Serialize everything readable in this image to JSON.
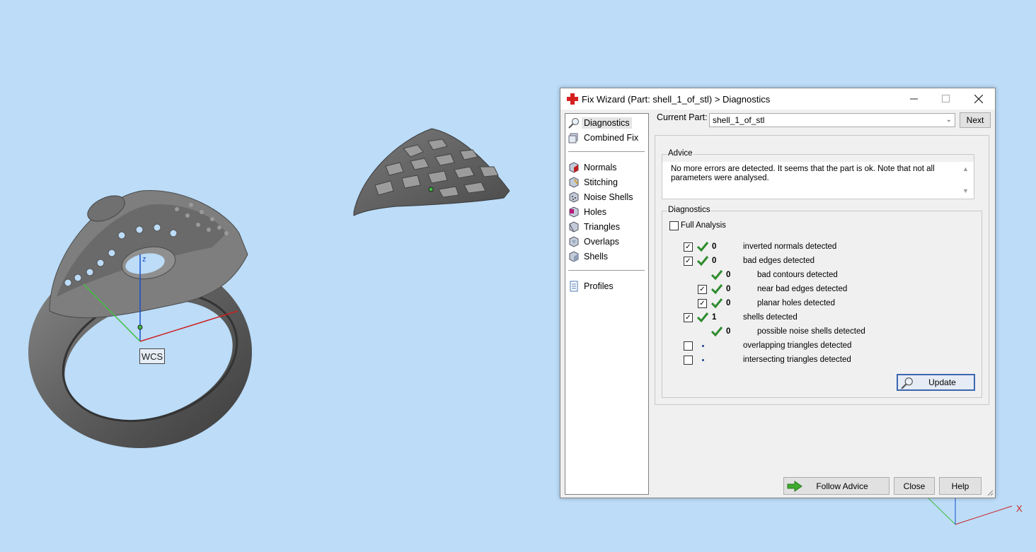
{
  "viewport": {
    "wcs_label": "WCS",
    "z_axis_label": "z",
    "x_axis_label": "X"
  },
  "window": {
    "title": "Fix Wizard (Part: shell_1_of_stl) > Diagnostics",
    "minimize_icon": "minimize-icon",
    "maximize_icon": "maximize-icon",
    "close_icon": "close-icon"
  },
  "sidebar": {
    "items": [
      {
        "label": "Diagnostics",
        "icon": "magnifier-icon"
      },
      {
        "label": "Combined Fix",
        "icon": "cube-stack-icon"
      },
      {
        "label": "Normals",
        "icon": "normals-cube-icon"
      },
      {
        "label": "Stitching",
        "icon": "stitching-cube-icon"
      },
      {
        "label": "Noise Shells",
        "icon": "noise-shells-icon"
      },
      {
        "label": "Holes",
        "icon": "holes-cube-icon"
      },
      {
        "label": "Triangles",
        "icon": "triangles-cube-icon"
      },
      {
        "label": "Overlaps",
        "icon": "overlaps-cube-icon"
      },
      {
        "label": "Shells",
        "icon": "shells-cube-icon"
      },
      {
        "label": "Profiles",
        "icon": "document-icon"
      }
    ]
  },
  "current_part": {
    "label": "Current Part:",
    "value": "shell_1_of_stl",
    "next_button": "Next"
  },
  "advice": {
    "title": "Advice",
    "text": "No more errors are detected. It seems that the part is ok. Note that not all parameters were analysed."
  },
  "diagnostics": {
    "title": "Diagnostics",
    "full_analysis_label": "Full Analysis",
    "full_analysis_checked": false,
    "rows": [
      {
        "checked": true,
        "has_checkbox": true,
        "status": "ok",
        "count": "0",
        "label": "inverted normals detected",
        "indent": 0
      },
      {
        "checked": true,
        "has_checkbox": true,
        "status": "ok",
        "count": "0",
        "label": "bad edges detected",
        "indent": 0
      },
      {
        "checked": false,
        "has_checkbox": false,
        "status": "ok",
        "count": "0",
        "label": "bad contours detected",
        "indent": 1
      },
      {
        "checked": true,
        "has_checkbox": true,
        "status": "ok",
        "count": "0",
        "label": "near bad edges detected",
        "indent": 1
      },
      {
        "checked": true,
        "has_checkbox": true,
        "status": "ok",
        "count": "0",
        "label": "planar holes detected",
        "indent": 1
      },
      {
        "checked": true,
        "has_checkbox": true,
        "status": "ok",
        "count": "1",
        "label": "shells detected",
        "indent": 0
      },
      {
        "checked": false,
        "has_checkbox": false,
        "status": "ok",
        "count": "0",
        "label": "possible noise shells detected",
        "indent": 1
      },
      {
        "checked": false,
        "has_checkbox": true,
        "status": "not-run",
        "count": "",
        "label": "overlapping triangles detected",
        "indent": 0
      },
      {
        "checked": false,
        "has_checkbox": true,
        "status": "not-run",
        "count": "",
        "label": "intersecting triangles detected",
        "indent": 0
      }
    ],
    "update_button": "Update"
  },
  "footer": {
    "follow_advice_button": "Follow Advice",
    "close_button": "Close",
    "help_button": "Help"
  },
  "colors": {
    "viewport_bg": "#bcdcf8",
    "ok_green": "#2e8b2e",
    "x_axis": "#cc2222",
    "y_axis": "#3fbf3f",
    "z_axis": "#1a4fc9"
  }
}
